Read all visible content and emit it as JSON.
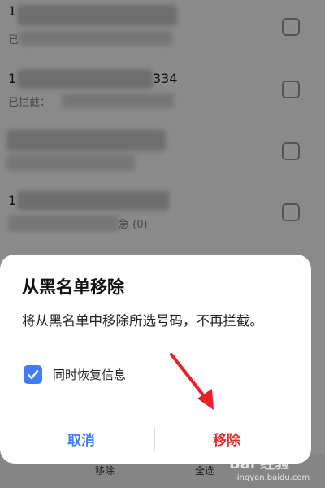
{
  "blocklist": {
    "rows": [
      {
        "number_tail": "",
        "sub": "已"
      },
      {
        "number_tail": "334",
        "sub": "已拦截："
      },
      {
        "number_tail": "",
        "sub": ""
      },
      {
        "number_tail": "",
        "sub": "急 (0)"
      }
    ],
    "bottom_bar": {
      "remove_label": "移除",
      "select_all_label": "全选"
    }
  },
  "dialog": {
    "title": "从黑名单移除",
    "message": "将从黑名单中移除所选号码，不再拦截。",
    "restore_checkbox": {
      "label": "同时恢复信息",
      "checked": true
    },
    "cancel_label": "取消",
    "remove_label": "移除"
  },
  "watermark": {
    "brand": "Bai 经验",
    "url": "jingyan.baidu.com"
  },
  "colors": {
    "accent_blue": "#3f7ef7",
    "danger_red": "#e0302c",
    "arrow_red": "#e8202a"
  }
}
